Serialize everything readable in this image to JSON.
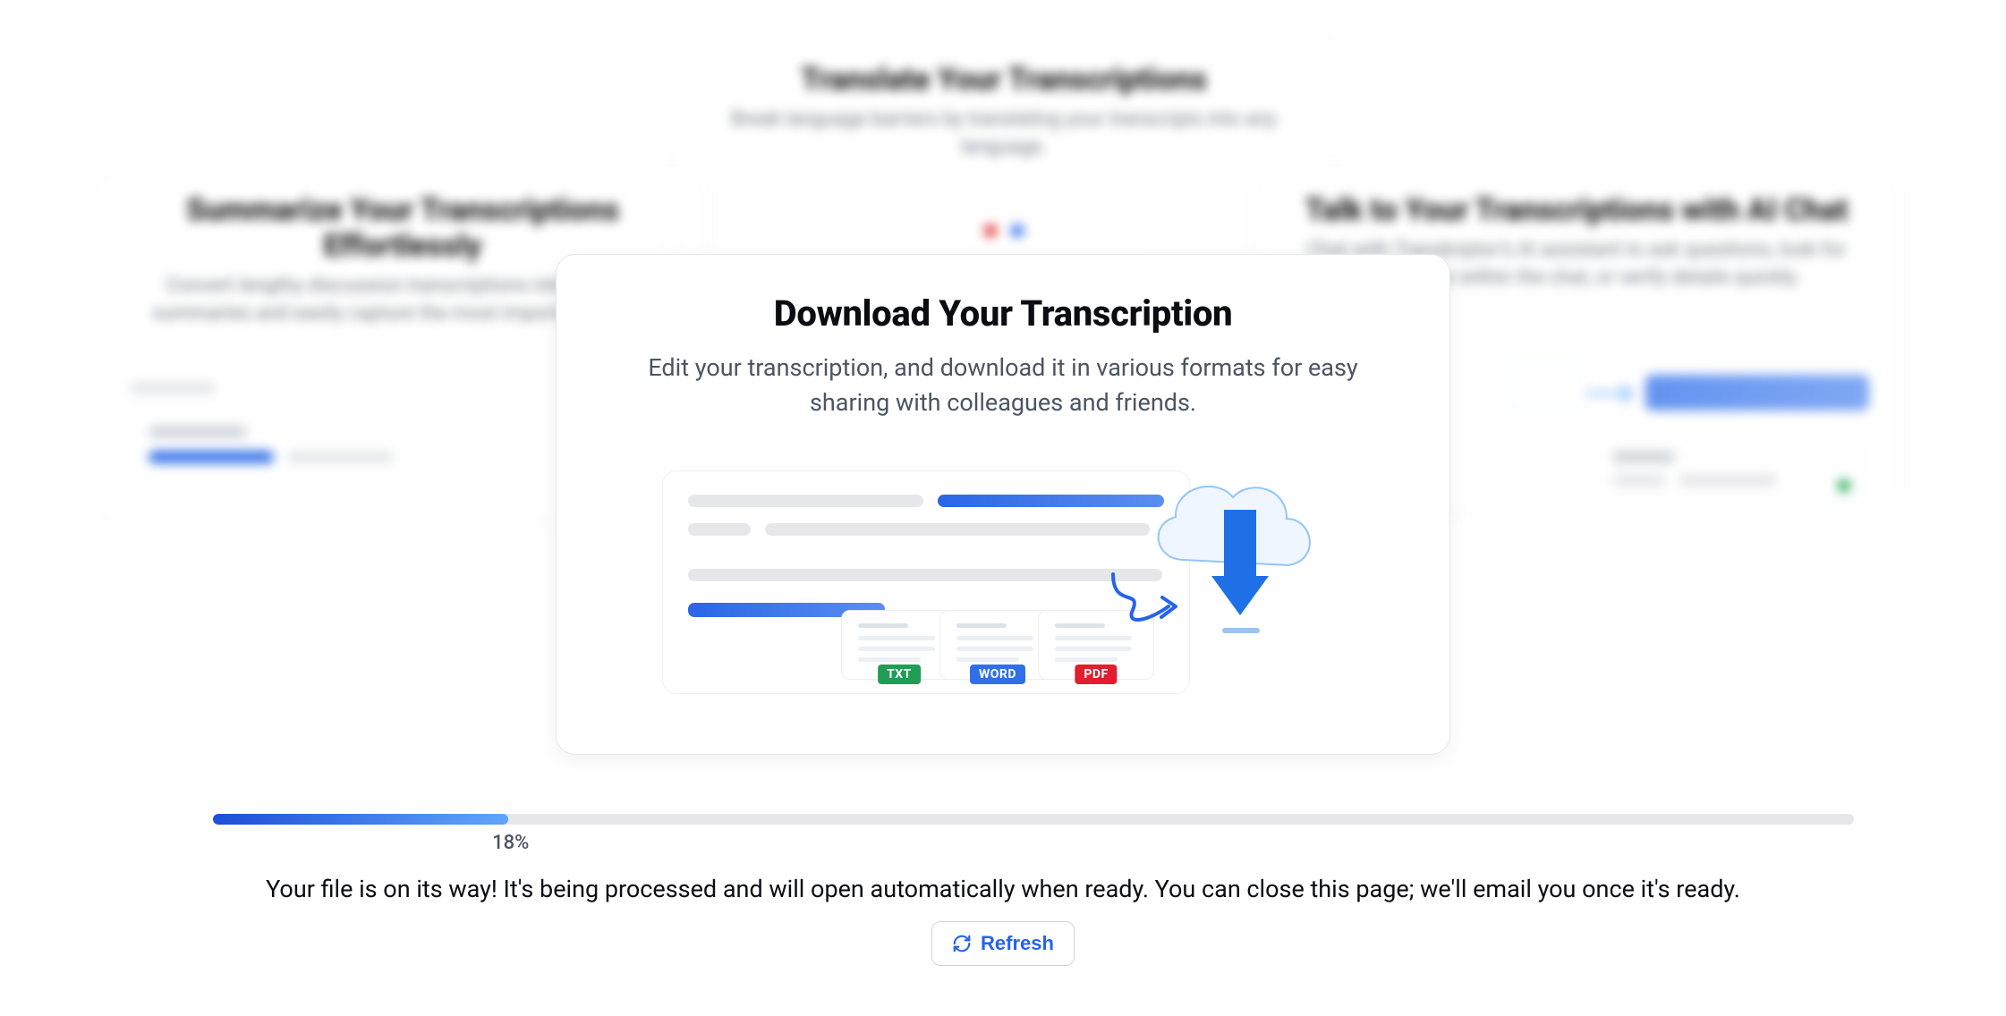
{
  "background_cards": {
    "top": {
      "title": "Translate Your Transcriptions",
      "subtitle": "Break language barriers by translating your transcripts into any language."
    },
    "left": {
      "title": "Summarize Your Transcriptions Effortlessly",
      "subtitle": "Convert lengthy discussion transcriptions into concise summaries and easily capture the most important points."
    },
    "right": {
      "title": "Talk to Your Transcriptions with AI Chat",
      "subtitle": "Chat with Transkriptor's AI assistant to ask questions, look for information within the chat, or verify details quickly."
    }
  },
  "feature": {
    "title": "Download Your Transcription",
    "subtitle": "Edit your transcription, and download it in various formats for easy sharing with colleagues and friends.",
    "formats": {
      "txt": "TXT",
      "word": "WORD",
      "pdf": "PDF"
    }
  },
  "progress": {
    "percent": 18,
    "label": "18%"
  },
  "status_text": "Your file is on its way! It's being processed and will open automatically when ready. You can close this page; we'll email you once it's ready.",
  "refresh_label": "Refresh",
  "colors": {
    "accent": "#2563eb",
    "txt_badge": "#1f9d55",
    "word_badge": "#2f6fe8",
    "pdf_badge": "#e11d2e"
  }
}
